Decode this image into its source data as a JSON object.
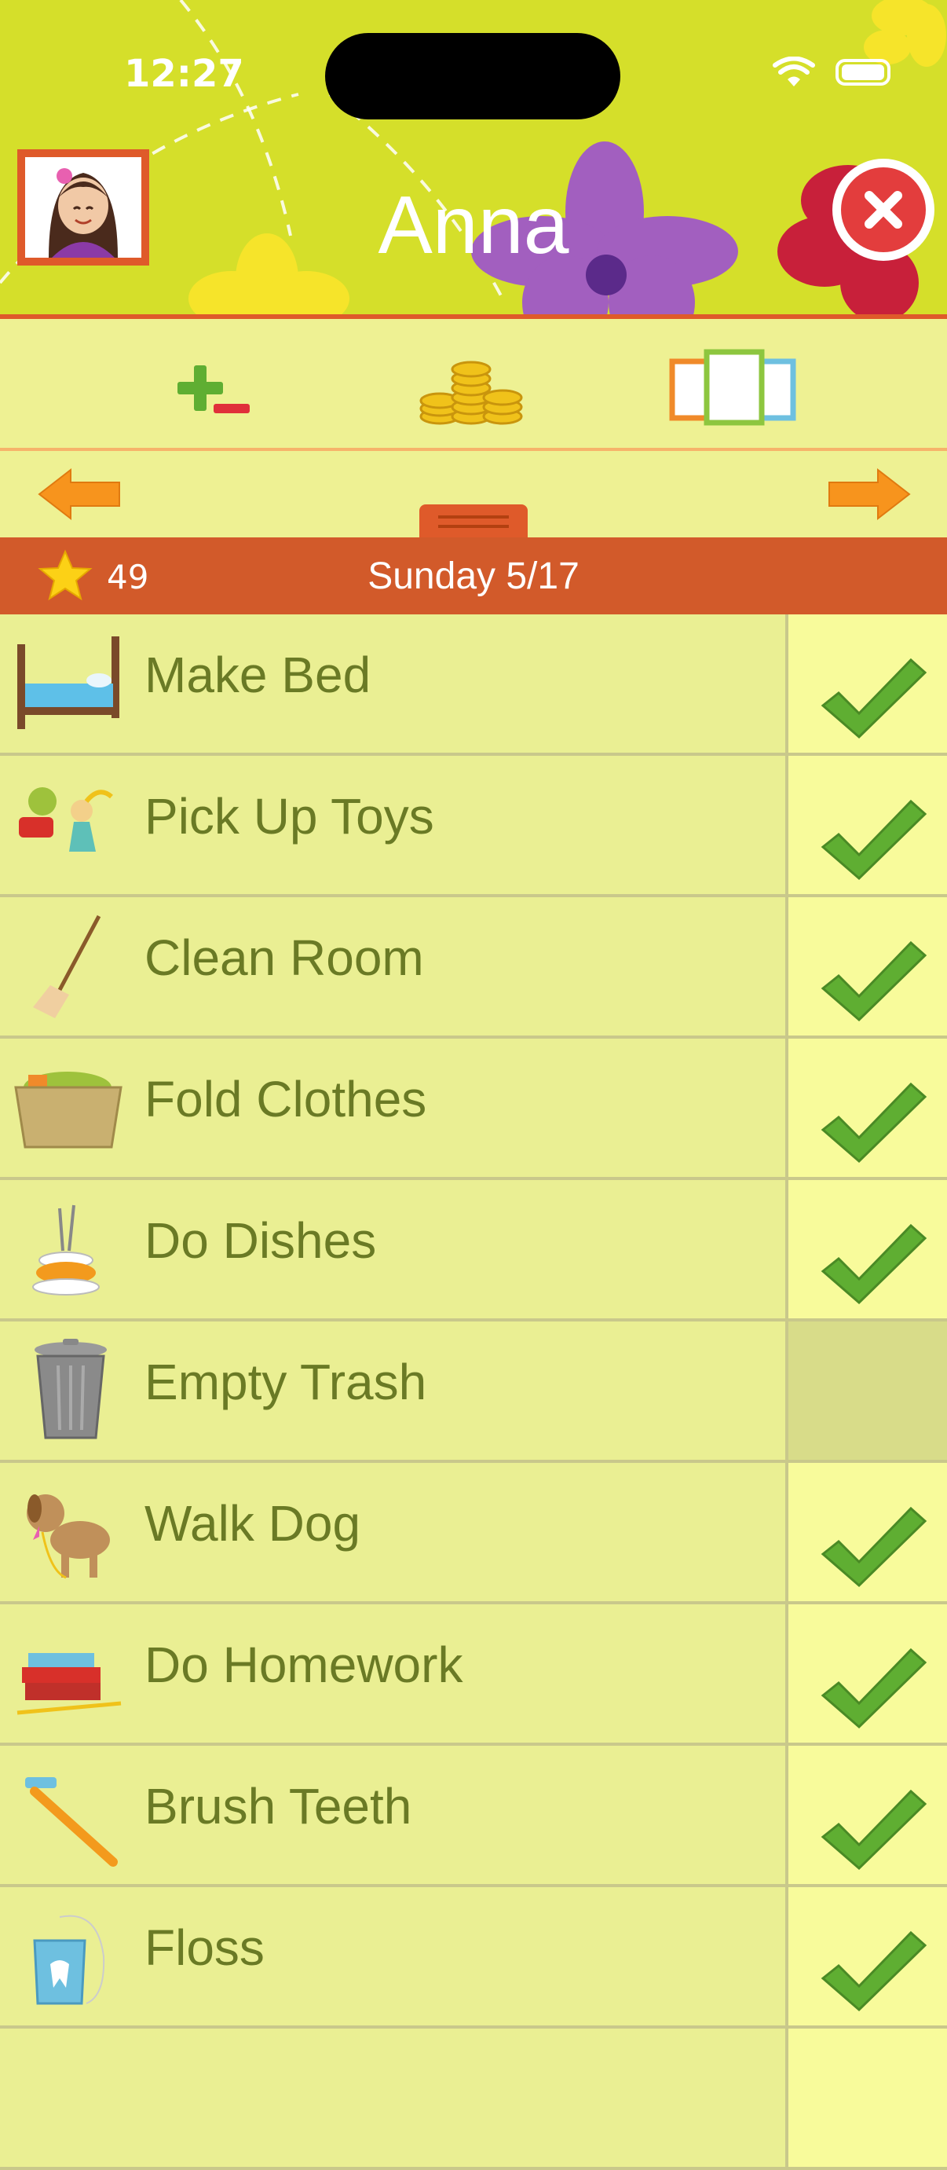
{
  "status_bar": {
    "time": "12:27"
  },
  "header": {
    "child_name": "Anna"
  },
  "score": {
    "stars": "49"
  },
  "date": "Sunday 5/17",
  "chores": [
    {
      "label": "Make Bed",
      "icon": "bed-icon",
      "done": true
    },
    {
      "label": "Pick Up Toys",
      "icon": "toys-icon",
      "done": true
    },
    {
      "label": "Clean Room",
      "icon": "broom-icon",
      "done": true
    },
    {
      "label": "Fold Clothes",
      "icon": "laundry-basket-icon",
      "done": true
    },
    {
      "label": "Do Dishes",
      "icon": "dishes-icon",
      "done": true
    },
    {
      "label": "Empty Trash",
      "icon": "trash-can-icon",
      "done": false
    },
    {
      "label": "Walk Dog",
      "icon": "dog-icon",
      "done": true
    },
    {
      "label": "Do Homework",
      "icon": "books-icon",
      "done": true
    },
    {
      "label": "Brush Teeth",
      "icon": "toothbrush-icon",
      "done": true
    },
    {
      "label": "Floss",
      "icon": "floss-icon",
      "done": true
    }
  ],
  "colors": {
    "header_bg": "#d5df2a",
    "accent_orange": "#d25a2a",
    "row_bg": "#eaef93",
    "check_green": "#5fae32",
    "label_text": "#6a7a25"
  }
}
